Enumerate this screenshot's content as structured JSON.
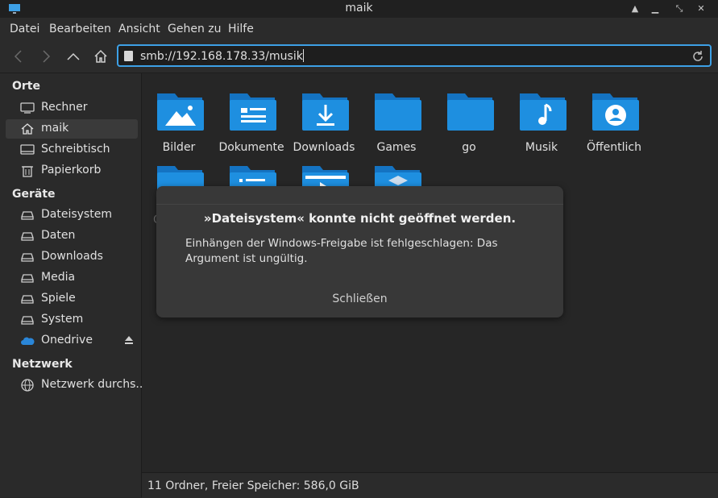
{
  "window": {
    "title": "maik"
  },
  "menu": [
    "Datei",
    "Bearbeiten",
    "Ansicht",
    "Gehen zu",
    "Hilfe"
  ],
  "location": {
    "value": "smb://192.168.178.33/musik"
  },
  "sidebar": {
    "places_heading": "Orte",
    "places": [
      {
        "label": "Rechner",
        "icon": "computer-icon"
      },
      {
        "label": "maik",
        "icon": "home-icon",
        "selected": true
      },
      {
        "label": "Schreibtisch",
        "icon": "desktop-icon"
      },
      {
        "label": "Papierkorb",
        "icon": "trash-icon"
      }
    ],
    "devices_heading": "Geräte",
    "devices": [
      {
        "label": "Dateisystem",
        "icon": "drive-icon"
      },
      {
        "label": "Daten",
        "icon": "drive-icon"
      },
      {
        "label": "Downloads",
        "icon": "drive-icon"
      },
      {
        "label": "Media",
        "icon": "drive-icon"
      },
      {
        "label": "Spiele",
        "icon": "drive-icon"
      },
      {
        "label": "System",
        "icon": "drive-icon"
      },
      {
        "label": "Onedrive",
        "icon": "cloud-icon"
      }
    ],
    "network_heading": "Netzwerk",
    "network": [
      {
        "label": "Netzwerk durchs...",
        "icon": "network-icon"
      }
    ]
  },
  "files": {
    "row1": [
      "Bilder",
      "Dokumente",
      "Downloads",
      "Games",
      "go",
      "Musik",
      "Öffentlich"
    ],
    "row2": [
      "Onedrive"
    ]
  },
  "status": {
    "text": "11 Ordner, Freier Speicher: 586,0 GiB"
  },
  "dialog": {
    "title": "»Dateisystem« konnte nicht geöffnet werden.",
    "message": "Einhängen der Windows-Freigabe ist fehlgeschlagen: Das Argument ist ungültig.",
    "close_label": "Schließen"
  },
  "colors": {
    "accent": "#3da0e6",
    "folder_front": "#1e8fe0",
    "folder_back": "#1473c2"
  }
}
